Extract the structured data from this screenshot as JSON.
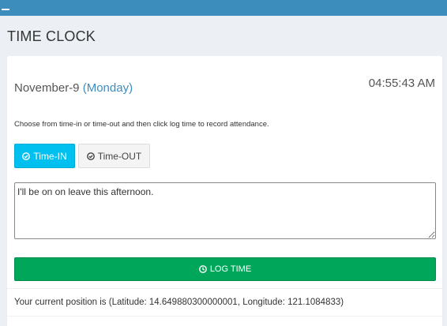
{
  "header": {
    "menu_icon": "minus-icon",
    "accent_color": "#3c8dbc"
  },
  "page": {
    "title": "TIME CLOCK"
  },
  "clock": {
    "date": "November-9",
    "day": "(Monday)",
    "time": "04:55:43 AM"
  },
  "instructions": "Choose from time-in or time-out and then click log time to record attendance.",
  "mode_buttons": {
    "time_in_label": "Time-IN",
    "time_out_label": "Time-OUT",
    "selected": "Time-IN",
    "icon": "check-circle-icon"
  },
  "remarks": {
    "value": "I'll be on on leave this afternoon."
  },
  "log_button": {
    "label": "LOG TIME",
    "icon": "clock-icon",
    "color": "#00a65a"
  },
  "position": {
    "text": "Your current position is (Latitude: 14.649880300000001, Longitude: 121.1084833)"
  }
}
